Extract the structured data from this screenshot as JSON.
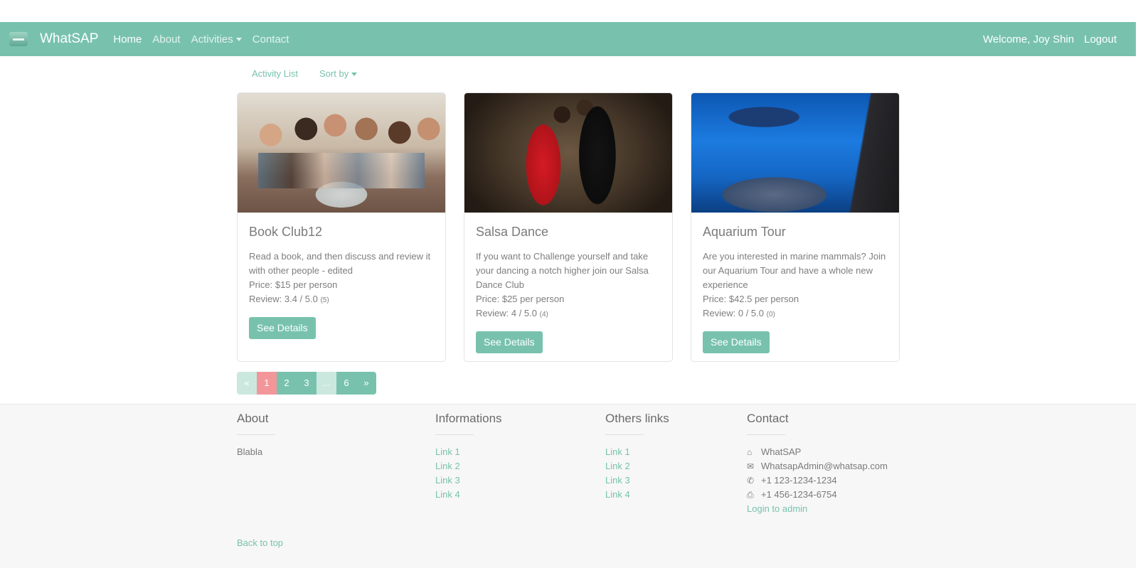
{
  "navbar": {
    "brand": "WhatSAP",
    "links": [
      "Home",
      "About",
      "Activities",
      "Contact"
    ],
    "welcome": "Welcome, Joy Shin",
    "logout": "Logout"
  },
  "subnav": {
    "activity_list": "Activity List",
    "sort_by": "Sort by"
  },
  "cards": [
    {
      "title": "Book Club12",
      "description": "Read a book, and then discuss and review it with other people - edited",
      "price": "Price: $15 per person",
      "review": "Review: 3.4 / 5.0",
      "review_count": "(5)",
      "button": "See Details"
    },
    {
      "title": "Salsa Dance",
      "description": "If you want to Challenge yourself and take your dancing a notch higher join our Salsa Dance Club",
      "price": "Price: $25 per person",
      "review": "Review: 4 / 5.0",
      "review_count": "(4)",
      "button": "See Details"
    },
    {
      "title": "Aquarium Tour",
      "description": "Are you interested in marine mammals? Join our Aquarium Tour and have a whole new experience",
      "price": "Price: $42.5 per person",
      "review": "Review: 0 / 5.0",
      "review_count": "(0)",
      "button": "See Details"
    }
  ],
  "pagination": [
    "«",
    "1",
    "2",
    "3",
    "...",
    "6",
    "»"
  ],
  "footer": {
    "about": {
      "title": "About",
      "text": "Blabla"
    },
    "informations": {
      "title": "Informations",
      "links": [
        "Link 1",
        "Link 2",
        "Link 3",
        "Link 4"
      ]
    },
    "others": {
      "title": "Others links",
      "links": [
        "Link 1",
        "Link 2",
        "Link 3",
        "Link 4"
      ]
    },
    "contact": {
      "title": "Contact",
      "name": "WhatSAP",
      "email": "WhatsapAdmin@whatsap.com",
      "phone": "+1 123-1234-1234",
      "fax": "+1 456-1234-6754",
      "admin_link": "Login to admin"
    },
    "back_to_top": "Back to top"
  },
  "colors": {
    "primary": "#78c2ad",
    "active_page": "#f3969a",
    "footer_bg": "#f7f7f7"
  }
}
